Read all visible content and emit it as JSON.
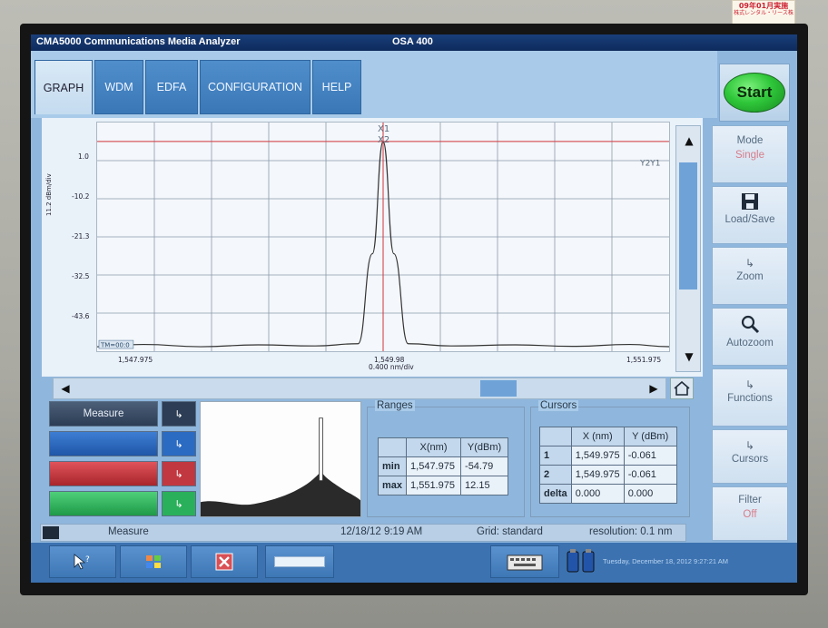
{
  "app_title": "CMA5000 Communications Media Analyzer",
  "module_title": "OSA 400",
  "tabs": [
    "GRAPH",
    "WDM",
    "EDFA",
    "CONFIGURATION",
    "HELP"
  ],
  "start_label": "Start",
  "side_buttons": {
    "mode_label": "Mode",
    "mode_value": "Single",
    "load_save_label": "Load/Save",
    "zoom_label": "Zoom",
    "autozoom_label": "Autozoom",
    "functions_label": "Functions",
    "cursors_label": "Cursors",
    "filter_label": "Filter",
    "filter_value": "Off",
    "submenu_arrow": "↳"
  },
  "graph": {
    "y_unit_label": "11.2 dBm/div",
    "y_ticks": [
      "1.0",
      "-10.2",
      "-21.3",
      "-32.5",
      "-43.6"
    ],
    "x_start": "1,547.975",
    "x_center": "1,549.98",
    "x_scale": "0.400 nm/div",
    "x_end": "1,551.975",
    "marker_x1": "X1",
    "marker_x2": "X2",
    "marker_y": "Y2Y1",
    "trace_tag": "TM=00:0"
  },
  "chart_data": {
    "type": "line",
    "title": "",
    "xlabel": "",
    "ylabel": "11.2 dBm/div",
    "x": [
      1547.975,
      1548.3,
      1548.7,
      1549.1,
      1549.5,
      1549.8,
      1549.9,
      1549.975,
      1550.05,
      1550.15,
      1550.45,
      1550.9,
      1551.3,
      1551.7,
      1551.975
    ],
    "y": [
      -54.8,
      -54.2,
      -54.8,
      -54.3,
      -54.6,
      -54.0,
      -30.0,
      -0.06,
      -30.0,
      -54.0,
      -54.6,
      -54.3,
      -54.7,
      -54.2,
      -54.79
    ],
    "xlim": [
      1547.975,
      1551.975
    ],
    "ylim": [
      -56,
      5
    ],
    "grid": true
  },
  "traces": {
    "measure_label": "Measure",
    "arrow": "↳"
  },
  "ranges": {
    "title": "Ranges",
    "headers": [
      "",
      "X(nm)",
      "Y(dBm)"
    ],
    "rows": [
      {
        "label": "min",
        "x": "1,547.975",
        "y": "-54.79"
      },
      {
        "label": "max",
        "x": "1,551.975",
        "y": "12.15"
      }
    ]
  },
  "cursors": {
    "title": "Cursors",
    "headers": [
      "",
      "X (nm)",
      "Y (dBm)"
    ],
    "rows": [
      {
        "label": "1",
        "x": "1,549.975",
        "y": "-0.061"
      },
      {
        "label": "2",
        "x": "1,549.975",
        "y": "-0.061"
      },
      {
        "label": "delta",
        "x": "0.000",
        "y": "0.000"
      }
    ]
  },
  "status": {
    "mode": "Measure",
    "timestamp": "12/18/12 9:19 AM",
    "grid": "Grid: standard",
    "resolution": "resolution: 0.1 nm"
  },
  "taskbar": {
    "clock": "Tuesday, December 18, 2012 9:27:21 AM"
  },
  "sticker": {
    "line1": "09年01月実施",
    "line2": "株式レンタル・リース株"
  },
  "colors": {
    "trace": "#333333",
    "cursor": "#d0353a",
    "accent_tab": "#3a77b7",
    "start_green": "#2fc73a"
  }
}
